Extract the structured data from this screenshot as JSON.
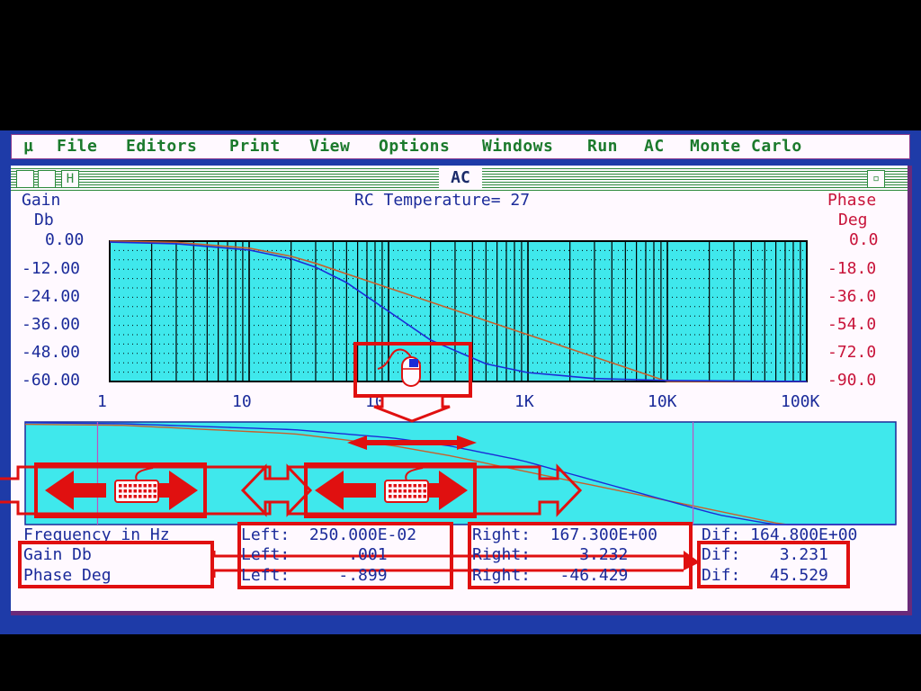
{
  "menu": {
    "items": [
      "µ",
      "File",
      "Editors",
      "Print",
      "View",
      "Options",
      "Windows",
      "Run",
      "AC",
      "Monte Carlo"
    ]
  },
  "window": {
    "title": "AC"
  },
  "chart": {
    "title": "RC Temperature= 27",
    "left_axis": {
      "label_line1": "Gain",
      "label_line2": "Db",
      "ticks": [
        "0.00",
        "-12.00",
        "-24.00",
        "-36.00",
        "-48.00",
        "-60.00"
      ]
    },
    "right_axis": {
      "label_line1": "Phase",
      "label_line2": "Deg",
      "ticks": [
        "0.0",
        "-18.0",
        "-36.0",
        "-54.0",
        "-72.0",
        "-90.0"
      ]
    },
    "x_ticks": [
      "1",
      "10",
      "100",
      "1K",
      "10K",
      "100K"
    ]
  },
  "chart_data": {
    "type": "line",
    "title": "RC Temperature= 27",
    "xlabel": "Frequency in Hz",
    "x_scale": "log",
    "xlim": [
      1,
      100000
    ],
    "ylim_left": [
      -60,
      0
    ],
    "ylim_right": [
      -90,
      0
    ],
    "x": [
      1,
      3,
      10,
      20,
      30,
      50,
      100,
      200,
      500,
      1000,
      3000,
      10000,
      100000
    ],
    "series": [
      {
        "name": "Gain Db",
        "axis": "left",
        "color": "#c8602a",
        "values": [
          0,
          -0.5,
          -3.0,
          -6.5,
          -9.5,
          -14,
          -20,
          -26,
          -34,
          -40,
          -49.5,
          -60,
          -60
        ]
      },
      {
        "name": "Phase Deg",
        "axis": "right",
        "color": "#1b2bd8",
        "values": [
          -0.6,
          -1.7,
          -5.7,
          -11.3,
          -16.7,
          -26.6,
          -45,
          -63.4,
          -78.7,
          -84.3,
          -88.1,
          -89.4,
          -90
        ]
      }
    ],
    "grid": true
  },
  "readouts": {
    "freq": {
      "name": "Frequency in Hz",
      "left": "Left:  250.000E-02",
      "right": "Right:  167.300E+00",
      "dif": "Dif: 164.800E+00"
    },
    "gain": {
      "name": "Gain Db",
      "left": "Left:      .001",
      "right": "Right:     3.232",
      "dif": "Dif:    3.231"
    },
    "phase": {
      "name": "Phase Deg",
      "left": "Left:     -.899",
      "right": "Right:   -46.429",
      "dif": "Dif:   45.529"
    }
  },
  "overlay_icons": {
    "mouse": "mouse-icon",
    "keyboard": "keyboard-icon",
    "arrow": "double-arrow-icon"
  },
  "colors": {
    "plot_bg": "#3fe8ec",
    "overlay_red": "#e01010",
    "menu_text": "#1b7a2c"
  }
}
